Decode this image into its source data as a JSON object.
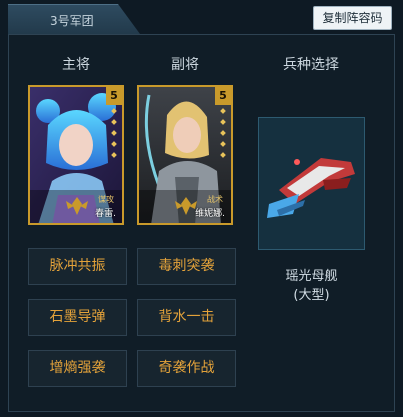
{
  "tab": {
    "label": "3号军团"
  },
  "toolbar": {
    "copy_label": "复制阵容码"
  },
  "columns": {
    "main": "主将",
    "vice": "副将",
    "unit": "兵种选择"
  },
  "cards": [
    {
      "star": "5",
      "role": "谋攻",
      "name": "春雷.",
      "accent": "#4fc3ff"
    },
    {
      "star": "5",
      "role": "战术",
      "name": "维妮娜.",
      "accent": "#c8a45c"
    }
  ],
  "unit": {
    "name_line1": "瑶光母舰",
    "name_line2": "(大型)"
  },
  "skills": [
    {
      "label": "脉冲共振"
    },
    {
      "label": "毒刺突袭"
    },
    {
      "label": "石墨导弹"
    },
    {
      "label": "背水一击"
    },
    {
      "label": "增熵强袭"
    },
    {
      "label": "奇袭作战"
    }
  ],
  "colors": {
    "accent_gold": "#c99a2b",
    "skill_text": "#e3a23a",
    "background": "#0e1a24"
  }
}
